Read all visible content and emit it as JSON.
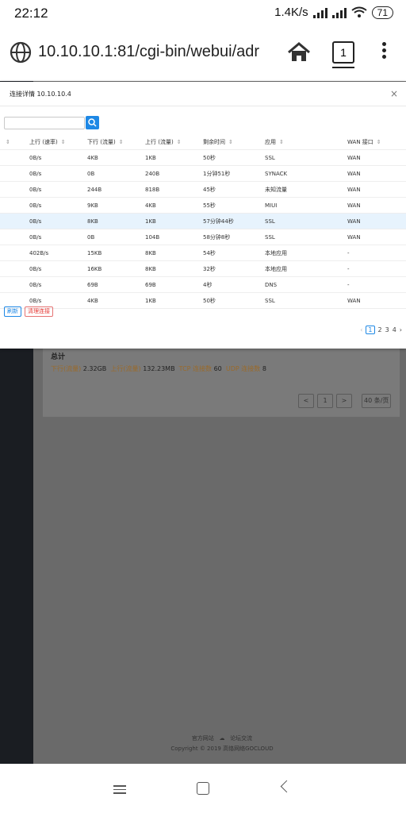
{
  "status": {
    "time": "22:12",
    "speed": "1.4K/s",
    "battery": "71"
  },
  "browser": {
    "url": "10.10.10.1:81/cgi-bin/webui/adr",
    "tab_count": "1"
  },
  "modal": {
    "title": "连接详情 10.10.10.4",
    "close": "×",
    "columns": [
      "上行 (速率)",
      "下行 (流量)",
      "上行 (流量)",
      "剩余时间",
      "应用",
      "WAN 接口"
    ],
    "rows": [
      [
        "0B/s",
        "4KB",
        "1KB",
        "50秒",
        "SSL",
        "WAN"
      ],
      [
        "0B/s",
        "0B",
        "240B",
        "1分钟51秒",
        "SYNACK",
        "WAN"
      ],
      [
        "0B/s",
        "244B",
        "818B",
        "45秒",
        "未知流量",
        "WAN"
      ],
      [
        "0B/s",
        "9KB",
        "4KB",
        "55秒",
        "MIUI",
        "WAN"
      ],
      [
        "0B/s",
        "8KB",
        "1KB",
        "57分钟44秒",
        "SSL",
        "WAN"
      ],
      [
        "0B/s",
        "0B",
        "104B",
        "58分钟8秒",
        "SSL",
        "WAN"
      ],
      [
        "402B/s",
        "15KB",
        "8KB",
        "54秒",
        "本地应用",
        "-"
      ],
      [
        "0B/s",
        "16KB",
        "8KB",
        "32秒",
        "本地应用",
        "-"
      ],
      [
        "0B/s",
        "69B",
        "69B",
        "4秒",
        "DNS",
        "-"
      ],
      [
        "0B/s",
        "4KB",
        "1KB",
        "50秒",
        "SSL",
        "WAN"
      ]
    ],
    "selected_row": 4,
    "refresh_label": "刷新",
    "clean_label": "清理连接",
    "pages": [
      "1",
      "2",
      "3",
      "4"
    ]
  },
  "background": {
    "totals_title": "总计",
    "totals": {
      "down_label": "下行(流量)",
      "down_value": "2.32GB",
      "up_label": "上行(流量)",
      "up_value": "132.23MB",
      "tcp_label": "TCP 连接数",
      "tcp_value": "60",
      "udp_label": "UDP 连接数",
      "udp_value": "8"
    },
    "pager": {
      "prev": "<",
      "page": "1",
      "next": ">",
      "per_page": "40 条/页"
    },
    "footer": {
      "official": "官方网站",
      "forum": "论坛交流",
      "copyright": "Copyright © 2019 高恪网络GOCLOUD"
    }
  },
  "colors": {
    "accent": "#1e88e5",
    "danger": "#e53935",
    "selected_row": "#e7f3fd",
    "sidebar": "#1a1d22"
  }
}
